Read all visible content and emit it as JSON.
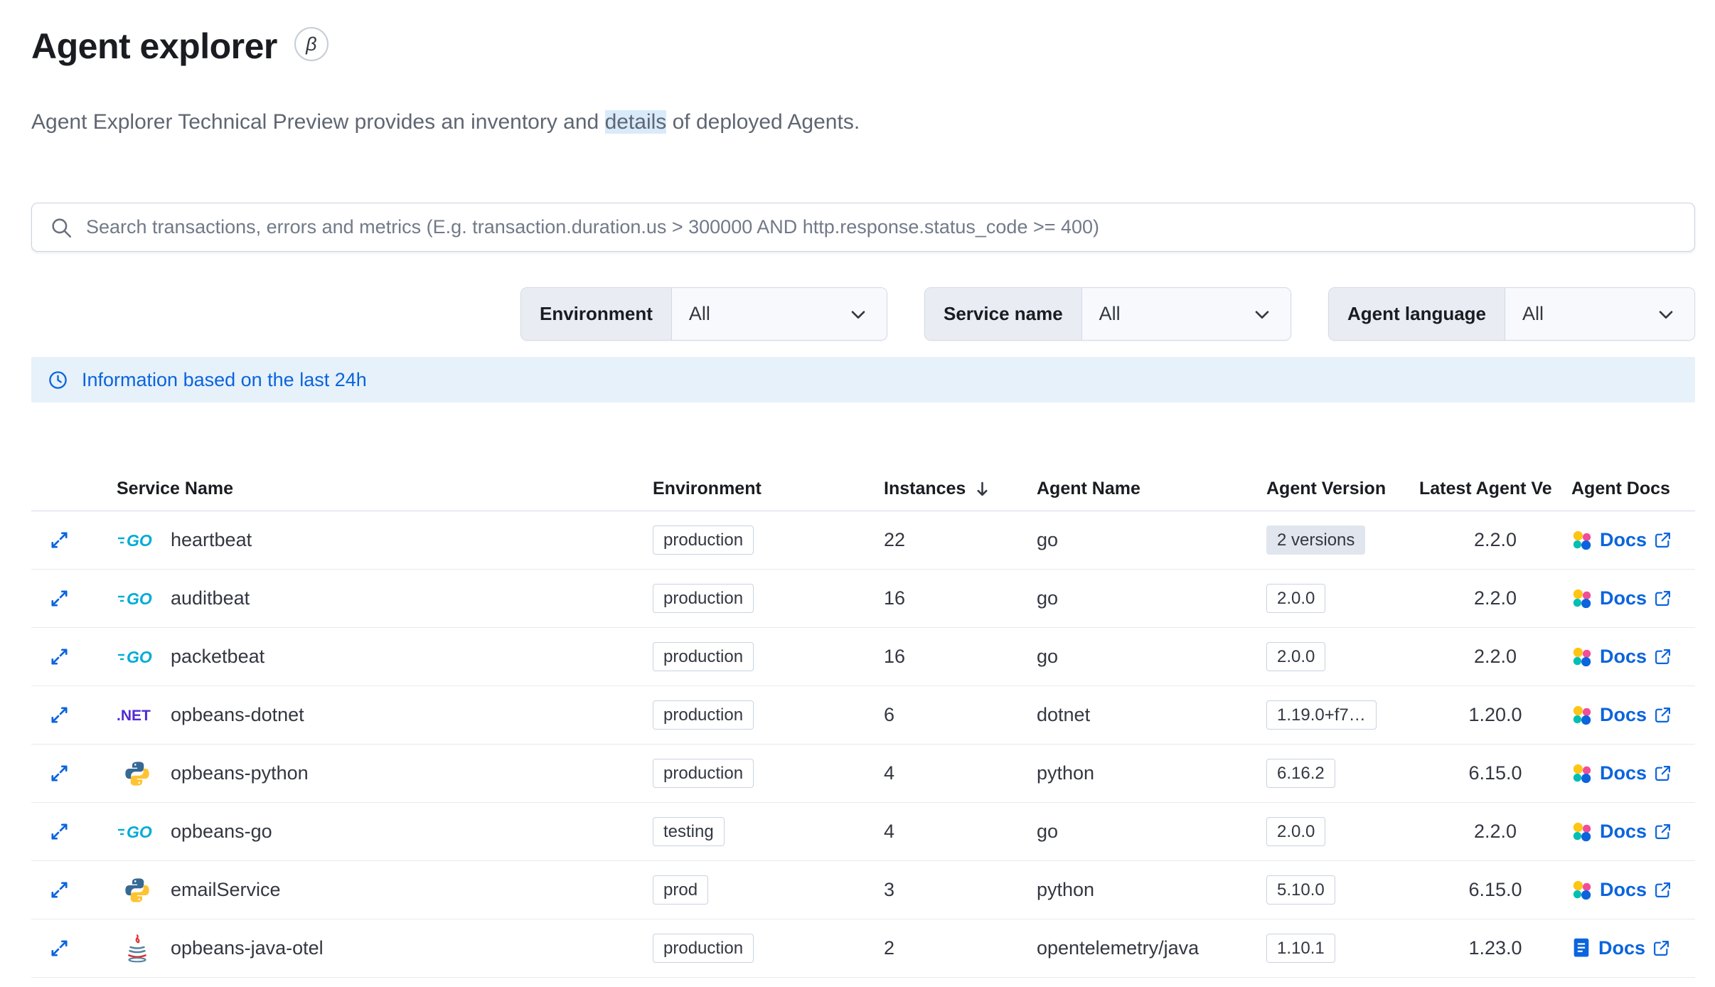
{
  "page": {
    "title": "Agent explorer",
    "beta_label": "β",
    "subtitle_pre": "Agent Explorer Technical Preview provides an inventory and ",
    "subtitle_highlight": "details",
    "subtitle_post": " of deployed Agents."
  },
  "search": {
    "placeholder": "Search transactions, errors and metrics (E.g. transaction.duration.us > 300000 AND http.response.status_code >= 400)",
    "value": ""
  },
  "filters": [
    {
      "label": "Environment",
      "value": "All"
    },
    {
      "label": "Service name",
      "value": "All"
    },
    {
      "label": "Agent language",
      "value": "All"
    }
  ],
  "banner": {
    "text": "Information based on the last 24h"
  },
  "table": {
    "headers": {
      "service": "Service Name",
      "environment": "Environment",
      "instances": "Instances",
      "agent_name": "Agent Name",
      "agent_version": "Agent Version",
      "latest_version": "Latest Agent Ve",
      "docs": "Agent Docs"
    },
    "sort": {
      "column": "Instances",
      "direction": "descending"
    },
    "rows": [
      {
        "service": "heartbeat",
        "language_icon": "go-logo-icon",
        "environment": "production",
        "instances": "22",
        "agent_name": "go",
        "agent_version": "2 versions",
        "version_badge": "filled",
        "latest_version": "2.2.0",
        "docs_label": "Docs",
        "docs_icon": "elastic-docs-icon"
      },
      {
        "service": "auditbeat",
        "language_icon": "go-logo-icon",
        "environment": "production",
        "instances": "16",
        "agent_name": "go",
        "agent_version": "2.0.0",
        "version_badge": "outlined",
        "latest_version": "2.2.0",
        "docs_label": "Docs",
        "docs_icon": "elastic-docs-icon"
      },
      {
        "service": "packetbeat",
        "language_icon": "go-logo-icon",
        "environment": "production",
        "instances": "16",
        "agent_name": "go",
        "agent_version": "2.0.0",
        "version_badge": "outlined",
        "latest_version": "2.2.0",
        "docs_label": "Docs",
        "docs_icon": "elastic-docs-icon"
      },
      {
        "service": "opbeans-dotnet",
        "language_icon": "dotnet-logo-icon",
        "environment": "production",
        "instances": "6",
        "agent_name": "dotnet",
        "agent_version": "1.19.0+f7…",
        "version_badge": "outlined",
        "latest_version": "1.20.0",
        "docs_label": "Docs",
        "docs_icon": "elastic-docs-icon"
      },
      {
        "service": "opbeans-python",
        "language_icon": "python-logo-icon",
        "environment": "production",
        "instances": "4",
        "agent_name": "python",
        "agent_version": "6.16.2",
        "version_badge": "outlined",
        "latest_version": "6.15.0",
        "docs_label": "Docs",
        "docs_icon": "elastic-docs-icon"
      },
      {
        "service": "opbeans-go",
        "language_icon": "go-logo-icon",
        "environment": "testing",
        "instances": "4",
        "agent_name": "go",
        "agent_version": "2.0.0",
        "version_badge": "outlined",
        "latest_version": "2.2.0",
        "docs_label": "Docs",
        "docs_icon": "elastic-docs-icon"
      },
      {
        "service": "emailService",
        "language_icon": "python-logo-icon",
        "environment": "prod",
        "instances": "3",
        "agent_name": "python",
        "agent_version": "5.10.0",
        "version_badge": "outlined",
        "latest_version": "6.15.0",
        "docs_label": "Docs",
        "docs_icon": "elastic-docs-icon"
      },
      {
        "service": "opbeans-java-otel",
        "language_icon": "java-logo-icon",
        "environment": "production",
        "instances": "2",
        "agent_name": "opentelemetry/java",
        "agent_version": "1.10.1",
        "version_badge": "outlined",
        "latest_version": "1.23.0",
        "docs_label": "Docs",
        "docs_icon": "otel-docs-icon"
      }
    ]
  },
  "colors": {
    "accent_blue": "#0b64dd",
    "banner_bg": "#e6f1fa",
    "highlight_bg": "#d9eafb",
    "badge_border": "#c9d3df",
    "filled_badge_bg": "#e0e5ee",
    "go_cyan": "#00ACD7",
    "dotnet_purple": "#512BD4",
    "elastic_yellow": "#FEC514",
    "elastic_teal": "#00BFB3",
    "elastic_pink": "#F04E98"
  }
}
